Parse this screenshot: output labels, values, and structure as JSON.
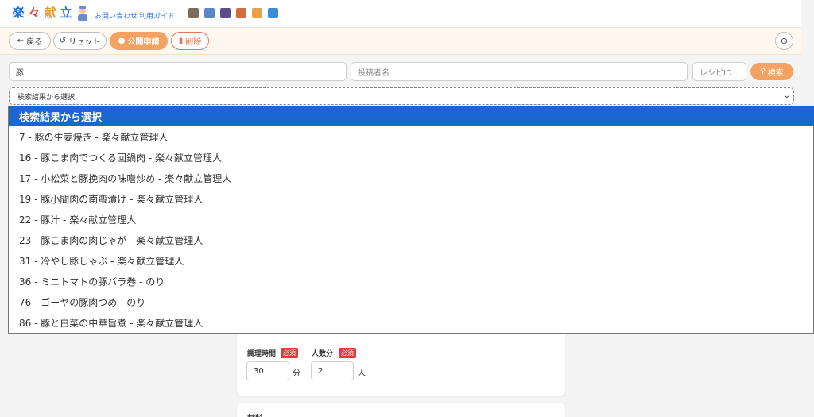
{
  "header": {
    "logo_chars": [
      "楽",
      "々",
      "献",
      "立"
    ],
    "logo_colors": [
      "#1f6fd6",
      "#e5413b",
      "#e89a2a",
      "#1f6fd6"
    ],
    "contact_label": "お問い合わせ",
    "guide_label": "利用ガイド",
    "icon_colors": [
      "#7b6d5b",
      "#5b87c7",
      "#5d4c8a",
      "#d66b3e",
      "#e8a04a",
      "#3a8fd4"
    ]
  },
  "toolbar": {
    "back_label": "戻る",
    "reset_label": "リセット",
    "publish_label": "公開申請",
    "delete_label": "削除"
  },
  "search": {
    "keyword_value": "豚",
    "author_placeholder": "投稿者名",
    "recipe_id_placeholder": "レシピID",
    "search_label": "検索"
  },
  "select": {
    "current_value": "検索結果から選択",
    "options": [
      "検索結果から選択",
      "7 - 豚の生姜焼き - 楽々献立管理人",
      "16 - 豚こま肉でつくる回鍋肉 - 楽々献立管理人",
      "17 - 小松菜と豚挽肉の味噌炒め - 楽々献立管理人",
      "19 - 豚小間肉の南蛮漬け - 楽々献立管理人",
      "22 - 豚汁 - 楽々献立管理人",
      "23 - 豚こま肉の肉じゃが - 楽々献立管理人",
      "31 - 冷やし豚しゃぶ - 楽々献立管理人",
      "36 - ミニトマトの豚バラ巻 - のり",
      "76 - ゴーヤの豚肉つめ - のり",
      "86 - 豚と白菜の中華旨煮 - 楽々献立管理人"
    ]
  },
  "form": {
    "cook_time_label": "調理時間",
    "servings_label": "人数分",
    "required_badge": "必須",
    "cook_time_value": "30",
    "cook_time_unit": "分",
    "servings_value": "2",
    "servings_unit": "人",
    "ingredients_title": "材料"
  }
}
